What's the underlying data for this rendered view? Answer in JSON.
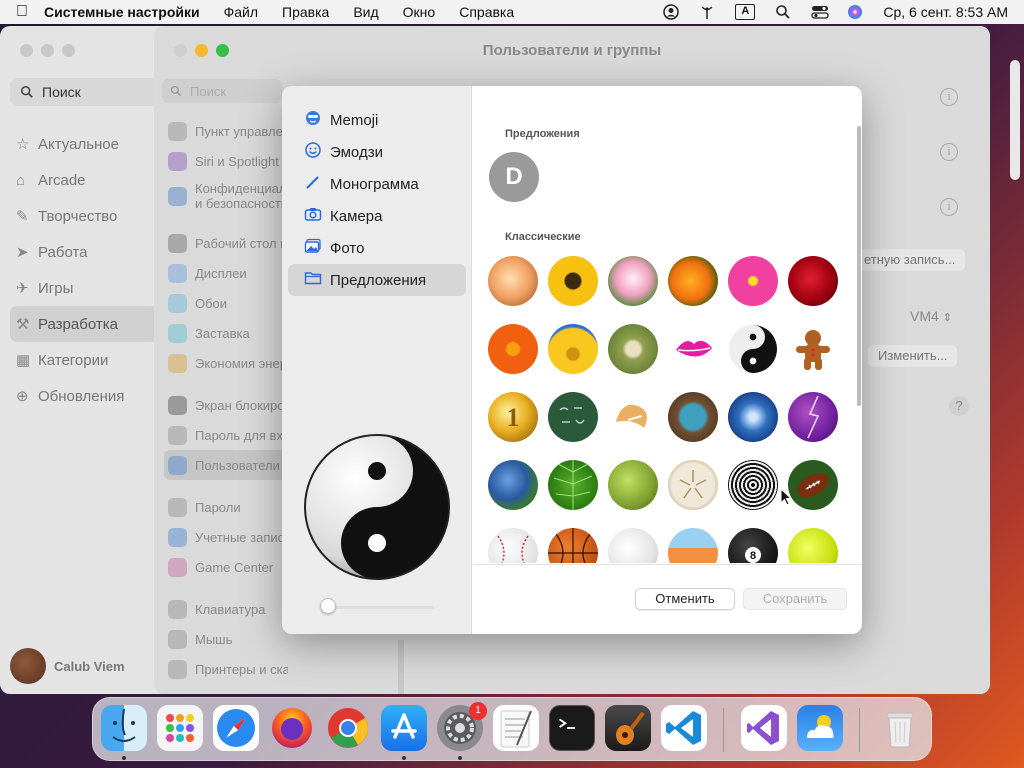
{
  "menubar": {
    "app_name": "Системные настройки",
    "items": [
      "Файл",
      "Правка",
      "Вид",
      "Окно",
      "Справка"
    ],
    "input_indicator": "A",
    "clock": "Ср, 6 сент.  8:53 AM"
  },
  "appstore_sidebar": {
    "search_label": "Поиск",
    "items": [
      {
        "label": "Актуальное",
        "icon": "star-icon"
      },
      {
        "label": "Arcade",
        "icon": "arcade-icon"
      },
      {
        "label": "Творчество",
        "icon": "brush-icon"
      },
      {
        "label": "Работа",
        "icon": "send-icon"
      },
      {
        "label": "Игры",
        "icon": "rocket-icon"
      },
      {
        "label": "Разработка",
        "icon": "hammer-icon"
      },
      {
        "label": "Категории",
        "icon": "grid-icon"
      },
      {
        "label": "Обновления",
        "icon": "download-icon"
      }
    ],
    "user_name": "Calub Viem"
  },
  "settings_window": {
    "title": "Пользователи и группы",
    "search_placeholder": "Поиск",
    "sidebar": [
      {
        "label": "Пункт управления"
      },
      {
        "label": "Siri и Spotlight"
      },
      {
        "label": "Конфиденциальность и безопасность"
      },
      {
        "label": "Рабочий стол и Dock"
      },
      {
        "label": "Дисплеи"
      },
      {
        "label": "Обои"
      },
      {
        "label": "Заставка"
      },
      {
        "label": "Экономия энергии"
      },
      {
        "label": "Экран блокировки"
      },
      {
        "label": "Пароль для входа"
      },
      {
        "label": "Пользователи и группы"
      },
      {
        "label": "Пароли"
      },
      {
        "label": "Учетные записи"
      },
      {
        "label": "Game Center"
      },
      {
        "label": "Клавиатура"
      },
      {
        "label": "Мышь"
      },
      {
        "label": "Принтеры и сканеры"
      }
    ],
    "account_button": "етную запись...",
    "vm_value": "VM4",
    "change_button": "Изменить...",
    "help": "?"
  },
  "picker": {
    "sources": [
      {
        "label": "Memoji",
        "icon": "memoji-icon"
      },
      {
        "label": "Эмодзи",
        "icon": "smiley-icon"
      },
      {
        "label": "Монограмма",
        "icon": "pen-icon"
      },
      {
        "label": "Камера",
        "icon": "camera-icon"
      },
      {
        "label": "Фото",
        "icon": "photo-icon"
      },
      {
        "label": "Предложения",
        "icon": "folder-icon"
      }
    ],
    "suggestions_title": "Предложения",
    "suggestion_letter": "D",
    "classic_title": "Классические",
    "cancel": "Отменить",
    "save": "Сохранить"
  },
  "dock": {
    "apps": [
      "finder",
      "launchpad",
      "safari",
      "firefox",
      "chrome",
      "app-store",
      "system-settings",
      "textedit",
      "terminal",
      "garageband",
      "vscode",
      "visual-studio",
      "weather",
      "trash"
    ],
    "settings_badge": "1"
  }
}
